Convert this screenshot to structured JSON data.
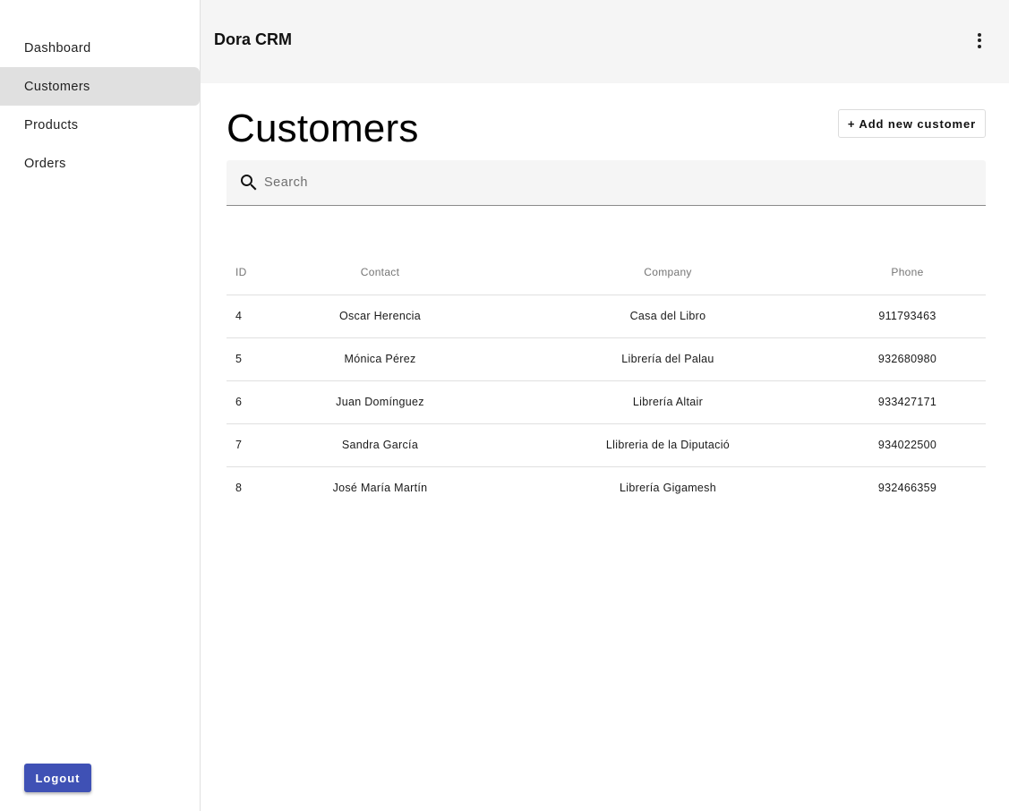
{
  "app": {
    "title": "Dora CRM",
    "menu_icon": "more-vert-icon"
  },
  "sidebar": {
    "items": [
      {
        "label": "Dashboard",
        "active": false
      },
      {
        "label": "Customers",
        "active": true
      },
      {
        "label": "Products",
        "active": false
      },
      {
        "label": "Orders",
        "active": false
      }
    ],
    "logout_label": "Logout"
  },
  "page": {
    "title": "Customers",
    "add_button_label": "+ Add new customer",
    "search": {
      "placeholder": "Search",
      "value": "",
      "icon": "search-icon"
    }
  },
  "table": {
    "columns": [
      "ID",
      "Contact",
      "Company",
      "Phone"
    ],
    "rows": [
      {
        "id": "4",
        "contact": "Oscar Herencia",
        "company": "Casa del Libro",
        "phone": "911793463"
      },
      {
        "id": "5",
        "contact": "Mónica Pérez",
        "company": "Librería del Palau",
        "phone": "932680980"
      },
      {
        "id": "6",
        "contact": "Juan Domínguez",
        "company": "Librería Altair",
        "phone": "933427171"
      },
      {
        "id": "7",
        "contact": "Sandra García",
        "company": "Llibreria de la Diputació",
        "phone": "934022500"
      },
      {
        "id": "8",
        "contact": "José María Martín",
        "company": "Librería Gigamesh",
        "phone": "932466359"
      }
    ]
  },
  "colors": {
    "primary": "#3f51b5",
    "appbar_bg": "#f5f5f5",
    "active_nav_bg": "#e0e0e0"
  }
}
